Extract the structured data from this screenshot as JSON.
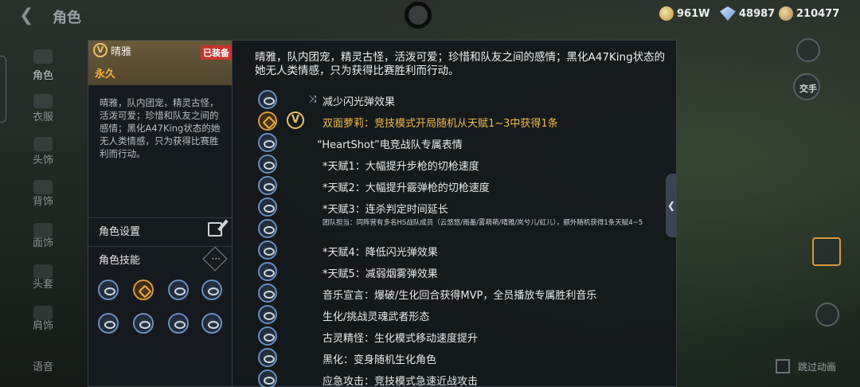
{
  "topbar": {
    "title": "角色",
    "currencies": [
      {
        "icon": "gold-coin-icon",
        "value": "961W"
      },
      {
        "icon": "diamond-icon",
        "value": "48987"
      },
      {
        "icon": "token-icon",
        "value": "210477"
      }
    ]
  },
  "leftnav": {
    "items": [
      {
        "label": "角色"
      },
      {
        "label": "衣服"
      },
      {
        "label": "头饰"
      },
      {
        "label": "背饰"
      },
      {
        "label": "面饰"
      },
      {
        "label": "头套"
      },
      {
        "label": "肩饰"
      },
      {
        "label": "语音"
      }
    ]
  },
  "card": {
    "badge": "V",
    "name": "晴雅",
    "equipped": "已装备",
    "duration": "永久",
    "description": "晴雅，队内团宠，精灵古怪，活泼可爱；珍惜和队友之间的感情；黑化A47King状态的她无人类情感，只为获得比赛胜利而行动。",
    "settings_label": "角色设置",
    "skills_label": "角色技能",
    "more_label": "···"
  },
  "detail": {
    "description": "晴雅，队内团宠，精灵古怪，活泼可爱；珍惜和队友之间的感情；黑化A47King状态的她无人类情感，只为获得比赛胜利而行动。",
    "badge": "V",
    "skills": [
      {
        "text": "减少闪光弹效果",
        "style": "normal",
        "icon": "flash-reduce-icon"
      },
      {
        "text": "双面萝莉：竞技模式开局随机从天赋1~3中获得1条",
        "style": "gold",
        "icon": "dual-face-icon"
      },
      {
        "text": "“HeartShot”电竞战队专属表情",
        "style": "normal",
        "icon": "emote-icon"
      },
      {
        "text": "*天赋1：大幅提升步枪的切枪速度",
        "style": "normal",
        "icon": "talent-rifle-icon"
      },
      {
        "text": "*天赋2：大幅提升霰弹枪的切枪速度",
        "style": "normal",
        "icon": "talent-shotgun-icon"
      },
      {
        "text": "*天赋3：连杀判定时间延长",
        "style": "normal",
        "icon": "talent-streak-icon"
      },
      {
        "text": "团队担当：同阵营有多名HS战队成员（云悠悠/雨墨/雾萌萌/晴雅/岚兮儿/虹儿），额外随机获得1条天赋4~5",
        "style": "small",
        "icon": "team-icon"
      },
      {
        "text": "*天赋4：降低闪光弹效果",
        "style": "normal",
        "icon": "talent-flash-icon"
      },
      {
        "text": "*天赋5：减弱烟雾弹效果",
        "style": "normal",
        "icon": "talent-smoke-icon"
      },
      {
        "text": "音乐宣言：爆破/生化回合获得MVP，全员播放专属胜利音乐",
        "style": "normal",
        "icon": "music-icon"
      },
      {
        "text": "生化/挑战灵魂武者形态",
        "style": "normal",
        "icon": "soul-warrior-icon"
      },
      {
        "text": "古灵精怪：生化模式移动速度提升",
        "style": "normal",
        "icon": "speed-icon"
      },
      {
        "text": "黑化：变身随机生化角色",
        "style": "normal",
        "icon": "transform-icon"
      },
      {
        "text": "应急攻击：竞技模式急速近战攻击",
        "style": "normal",
        "icon": "melee-icon"
      }
    ]
  },
  "right": {
    "switch_hand_label": "交手",
    "skip_anim_label": "跳过动画"
  }
}
